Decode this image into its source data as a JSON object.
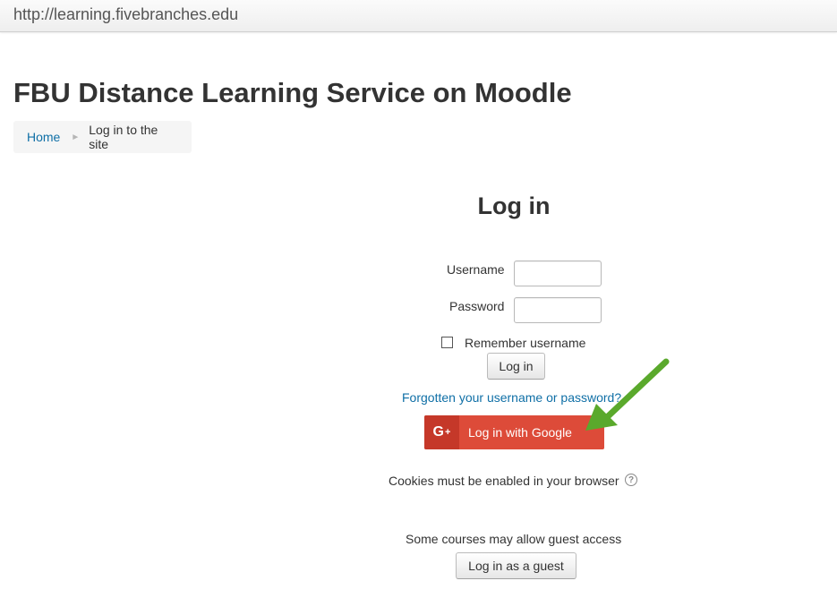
{
  "browser": {
    "url": "http://learning.fivebranches.edu"
  },
  "header": {
    "site_title": "FBU Distance Learning Service on Moodle"
  },
  "breadcrumb": {
    "home": "Home",
    "separator": "►",
    "current": "Log in to the site"
  },
  "login": {
    "heading": "Log in",
    "username_label": "Username",
    "username_value": "",
    "password_label": "Password",
    "password_value": "",
    "remember_label": "Remember username",
    "remember_checked": false,
    "login_button": "Log in",
    "forgot_link": "Forgotten your username or password?",
    "google_icon_text": "G",
    "google_icon_plus": "+",
    "google_button": "Log in with Google",
    "cookies_text": "Cookies must be enabled in your browser",
    "help_icon_text": "?",
    "guest_text": "Some courses may allow guest access",
    "guest_button": "Log in as a guest"
  },
  "colors": {
    "link": "#0f6fa6",
    "google_red": "#dd4b39",
    "google_icon_bg": "#c53829",
    "arrow_green": "#5aa92c"
  },
  "icons": {
    "google": "google-plus-icon",
    "help": "question-circle-icon",
    "arrow": "green-pointer-arrow-icon"
  }
}
